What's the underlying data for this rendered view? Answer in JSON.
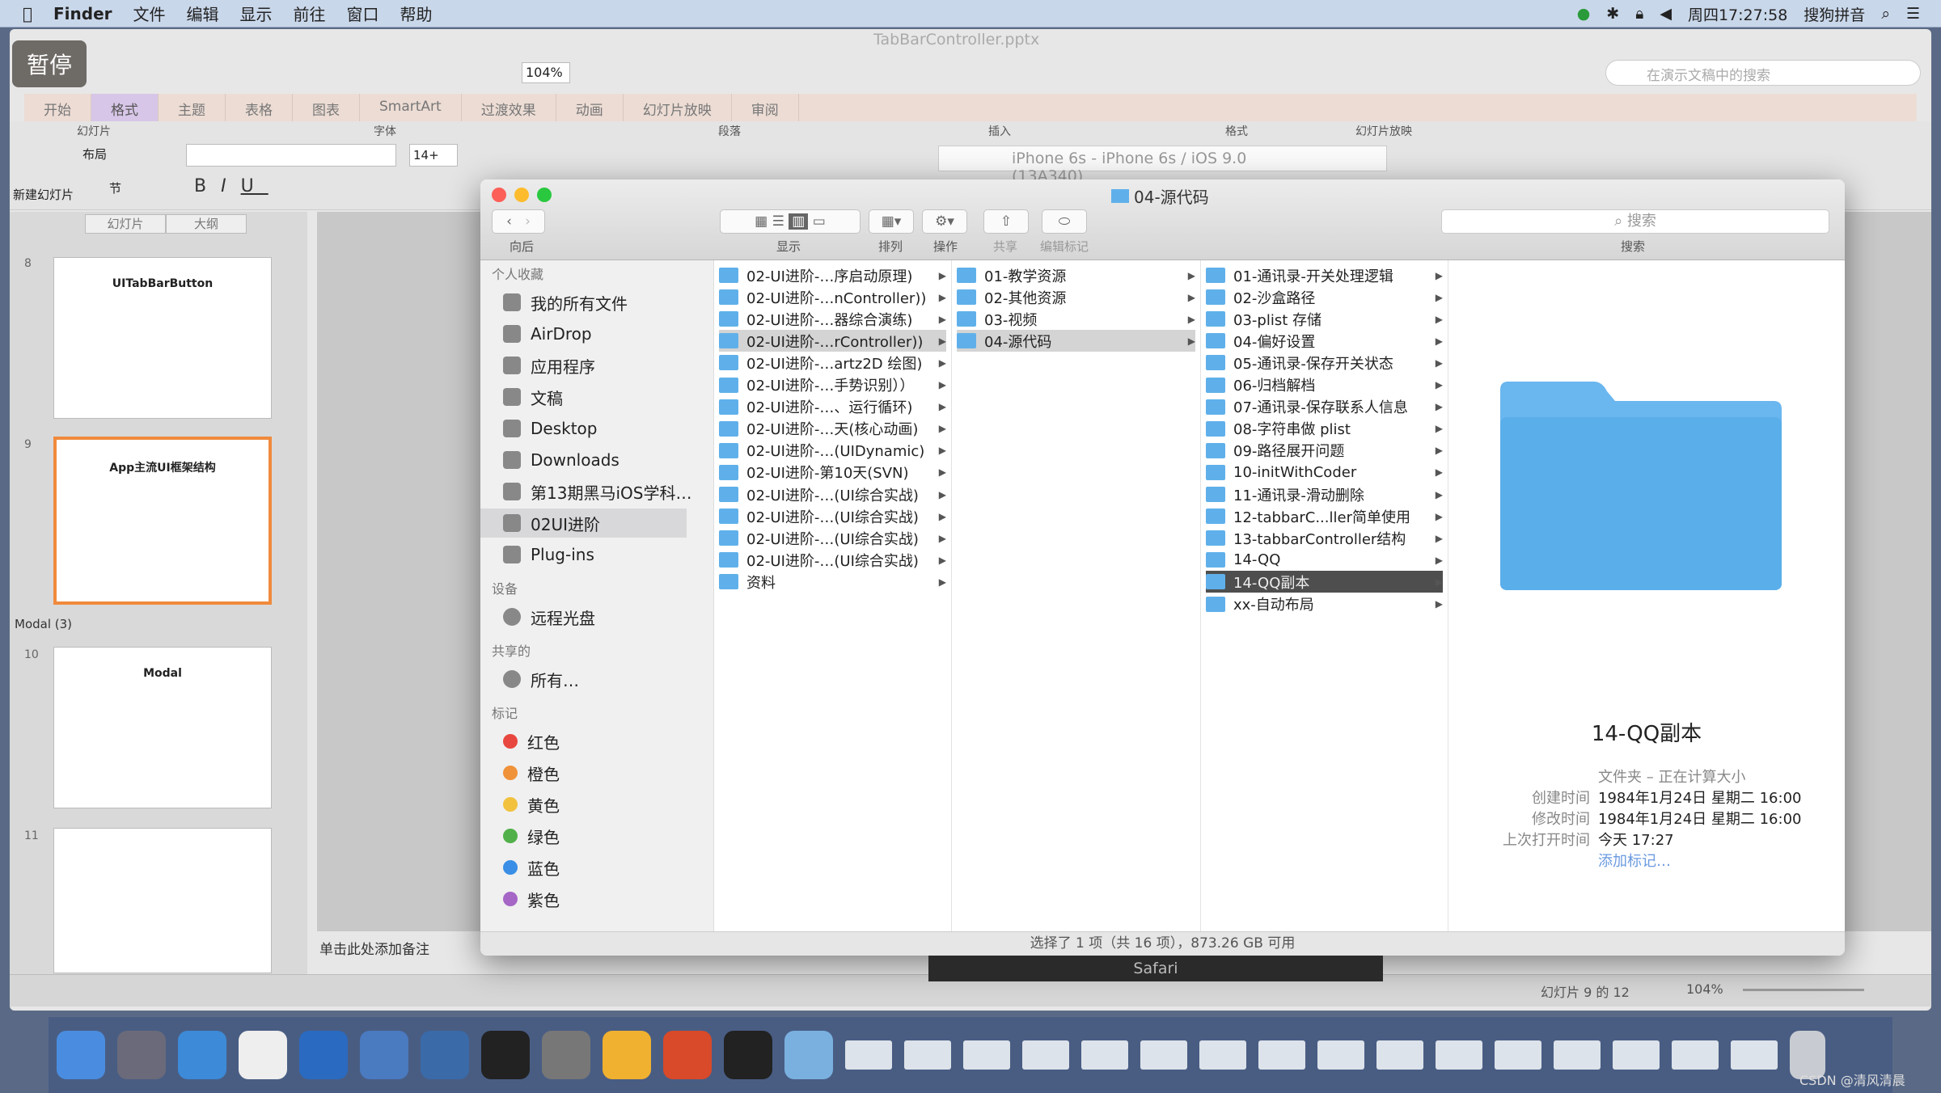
{
  "menubar": {
    "app": "Finder",
    "items": [
      "文件",
      "编辑",
      "显示",
      "前往",
      "窗口",
      "帮助"
    ],
    "clock": "周四17:27:58",
    "ime": "搜狗拼音"
  },
  "overlay": {
    "pause": "暂停"
  },
  "ppt": {
    "title": "TabBarController.pptx",
    "zoom": "104%",
    "search_placeholder": "在演示文稿中的搜索",
    "tabs": [
      "开始",
      "格式",
      "主题",
      "表格",
      "图表",
      "SmartArt",
      "过渡效果",
      "动画",
      "幻灯片放映",
      "审阅"
    ],
    "groups": [
      "幻灯片",
      "字体",
      "段落",
      "插入",
      "格式",
      "幻灯片放映"
    ],
    "buttons": {
      "new_slide": "新建幻灯片",
      "layout": "布局",
      "section": "节",
      "font_size": "14+"
    },
    "panel_tabs": [
      "幻灯片",
      "大纲"
    ],
    "slides": [
      {
        "num": "8",
        "title": "UITabBarButton"
      },
      {
        "num": "9",
        "title": "App主流UI框架结构"
      },
      {
        "num": "10",
        "title": "Modal"
      },
      {
        "num": "11",
        "title": ""
      }
    ],
    "section": "Modal (3)",
    "notes": "单击此处添加备注",
    "slide_count": "幻灯片 9 的 12",
    "zoom_status": "104%"
  },
  "simulator": {
    "title": "iPhone 6s - iPhone 6s / iOS 9.0 (13A340)"
  },
  "finder": {
    "title": "04-源代码",
    "toolbar": {
      "back": "向后",
      "view": "显示",
      "arrange": "排列",
      "action": "操作",
      "share": "共享",
      "tags": "编辑标记",
      "search": "搜索",
      "search_placeholder": "搜索"
    },
    "sidebar": {
      "favorites_header": "个人收藏",
      "favorites": [
        "我的所有文件",
        "AirDrop",
        "应用程序",
        "文稿",
        "Desktop",
        "Downloads",
        "第13期黑马iOS学科…",
        "02UI进阶",
        "Plug-ins"
      ],
      "devices_header": "设备",
      "devices": [
        "远程光盘"
      ],
      "shared_header": "共享的",
      "shared": [
        "所有…"
      ],
      "tags_header": "标记",
      "tags": [
        {
          "label": "红色",
          "color": "#e8473f"
        },
        {
          "label": "橙色",
          "color": "#f0923a"
        },
        {
          "label": "黄色",
          "color": "#f2c23e"
        },
        {
          "label": "绿色",
          "color": "#52b04a"
        },
        {
          "label": "蓝色",
          "color": "#3a8ee6"
        },
        {
          "label": "紫色",
          "color": "#a566c6"
        }
      ],
      "selected": "02UI进阶"
    },
    "columns": [
      {
        "items": [
          "02-UI进阶-…序启动原理)",
          "02-UI进阶-…nController))",
          "02-UI进阶-…器综合演练)",
          "02-UI进阶-…rController))",
          "02-UI进阶-…artz2D 绘图)",
          "02-UI进阶-…手势识别））",
          "02-UI进阶-…、运行循环)",
          "02-UI进阶-…天(核心动画)",
          "02-UI进阶-…(UIDynamic)",
          "02-UI进阶-第10天(SVN)",
          "02-UI进阶-…(UI综合实战)",
          "02-UI进阶-…(UI综合实战)",
          "02-UI进阶-…(UI综合实战)",
          "02-UI进阶-…(UI综合实战)",
          "资料"
        ],
        "selected": 3
      },
      {
        "items": [
          "01-教学资源",
          "02-其他资源",
          "03-视频",
          "04-源代码"
        ],
        "selected": 3
      },
      {
        "items": [
          "01-通讯录-开关处理逻辑",
          "02-沙盒路径",
          "03-plist 存储",
          "04-偏好设置",
          "05-通讯录-保存开关状态",
          "06-归档解档",
          "07-通讯录-保存联系人信息",
          "08-字符串做 plist",
          "09-路径展开问题",
          "10-initWithCoder",
          "11-通讯录-滑动删除",
          "12-tabbarC...ller简单使用",
          "13-tabbarController结构",
          "14-QQ",
          "14-QQ副本",
          "xx-自动布局"
        ],
        "active": 14
      }
    ],
    "preview": {
      "name": "14-QQ副本",
      "kind": "文件夹 – 正在计算大小",
      "created_label": "创建时间",
      "created": "1984年1月24日 星期二 16:00",
      "modified_label": "修改时间",
      "modified": "1984年1月24日 星期二 16:00",
      "opened_label": "上次打开时间",
      "opened": "今天 17:27",
      "add_tags": "添加标记…"
    },
    "status": "选择了 1 项（共 16 项），873.26 GB 可用"
  },
  "tooltip": "Safari",
  "watermark": "CSDN @清风清晨",
  "colors": {
    "folder": "#5fb0ea",
    "selection_active": "#4e4e4e",
    "menubar": "#c9d7ea"
  }
}
